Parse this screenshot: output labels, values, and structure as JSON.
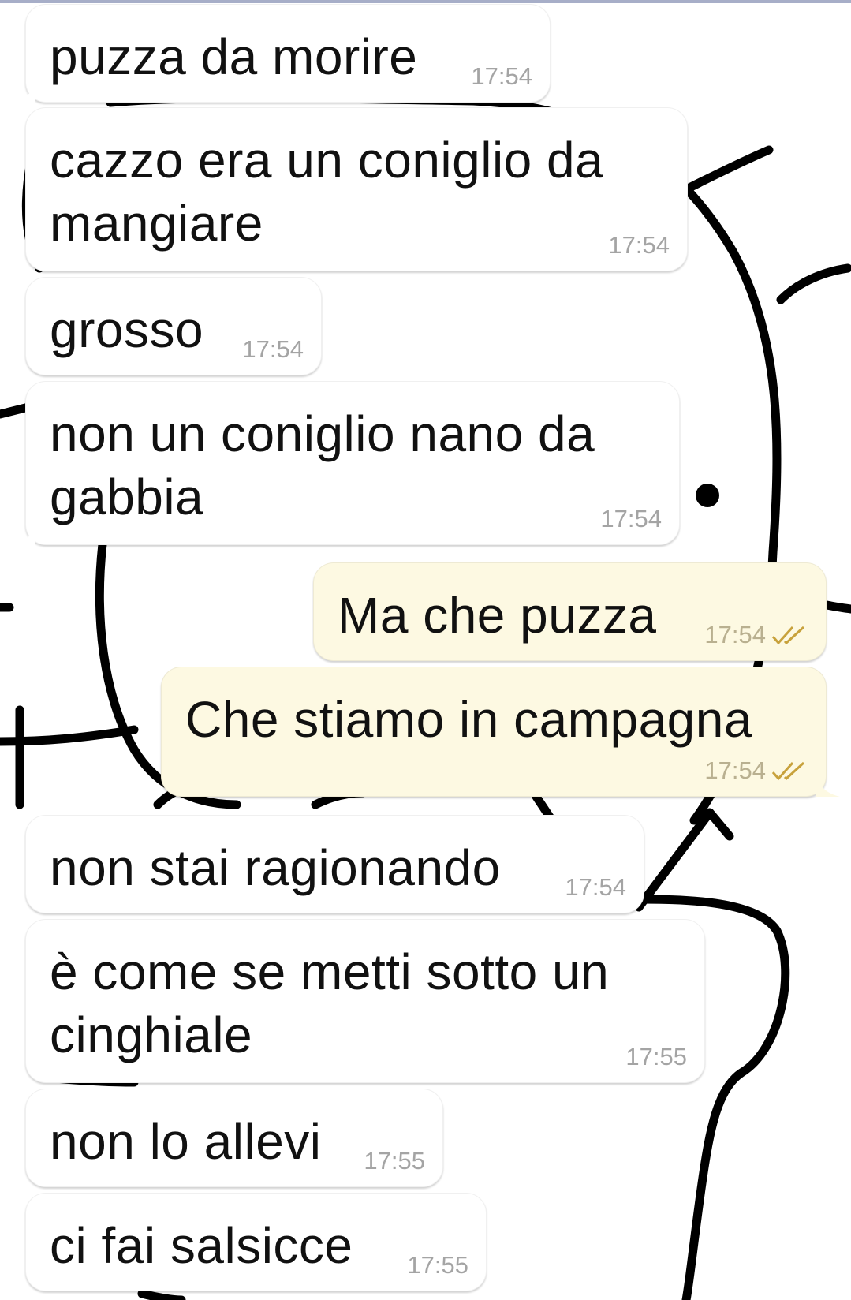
{
  "chat": {
    "messages": [
      {
        "direction": "in",
        "text": "puzza da morire",
        "time": "17:54"
      },
      {
        "direction": "in",
        "text": "cazzo era un coniglio da mangiare",
        "time": "17:54"
      },
      {
        "direction": "in",
        "text": "grosso",
        "time": "17:54"
      },
      {
        "direction": "in",
        "text": "non un coniglio nano da gabbia",
        "time": "17:54"
      },
      {
        "direction": "out",
        "text": "Ma che puzza",
        "time": "17:54",
        "status": "read"
      },
      {
        "direction": "out",
        "text": "Che stiamo in campagna",
        "time": "17:54",
        "status": "read"
      },
      {
        "direction": "in",
        "text": "non stai ragionando",
        "time": "17:54"
      },
      {
        "direction": "in",
        "text": "è come se metti sotto un cinghiale",
        "time": "17:55"
      },
      {
        "direction": "in",
        "text": "non lo allevi",
        "time": "17:55"
      },
      {
        "direction": "in",
        "text": "ci fai salsicce",
        "time": "17:55"
      }
    ],
    "colors": {
      "incoming_bubble": "#ffffff",
      "outgoing_bubble": "#fdf9e2",
      "timestamp": "#a4a4a4",
      "read_ticks": "#c8a23c",
      "wallpaper_lines": "#000000"
    },
    "icons": {
      "read_status": "double-check-icon"
    }
  }
}
